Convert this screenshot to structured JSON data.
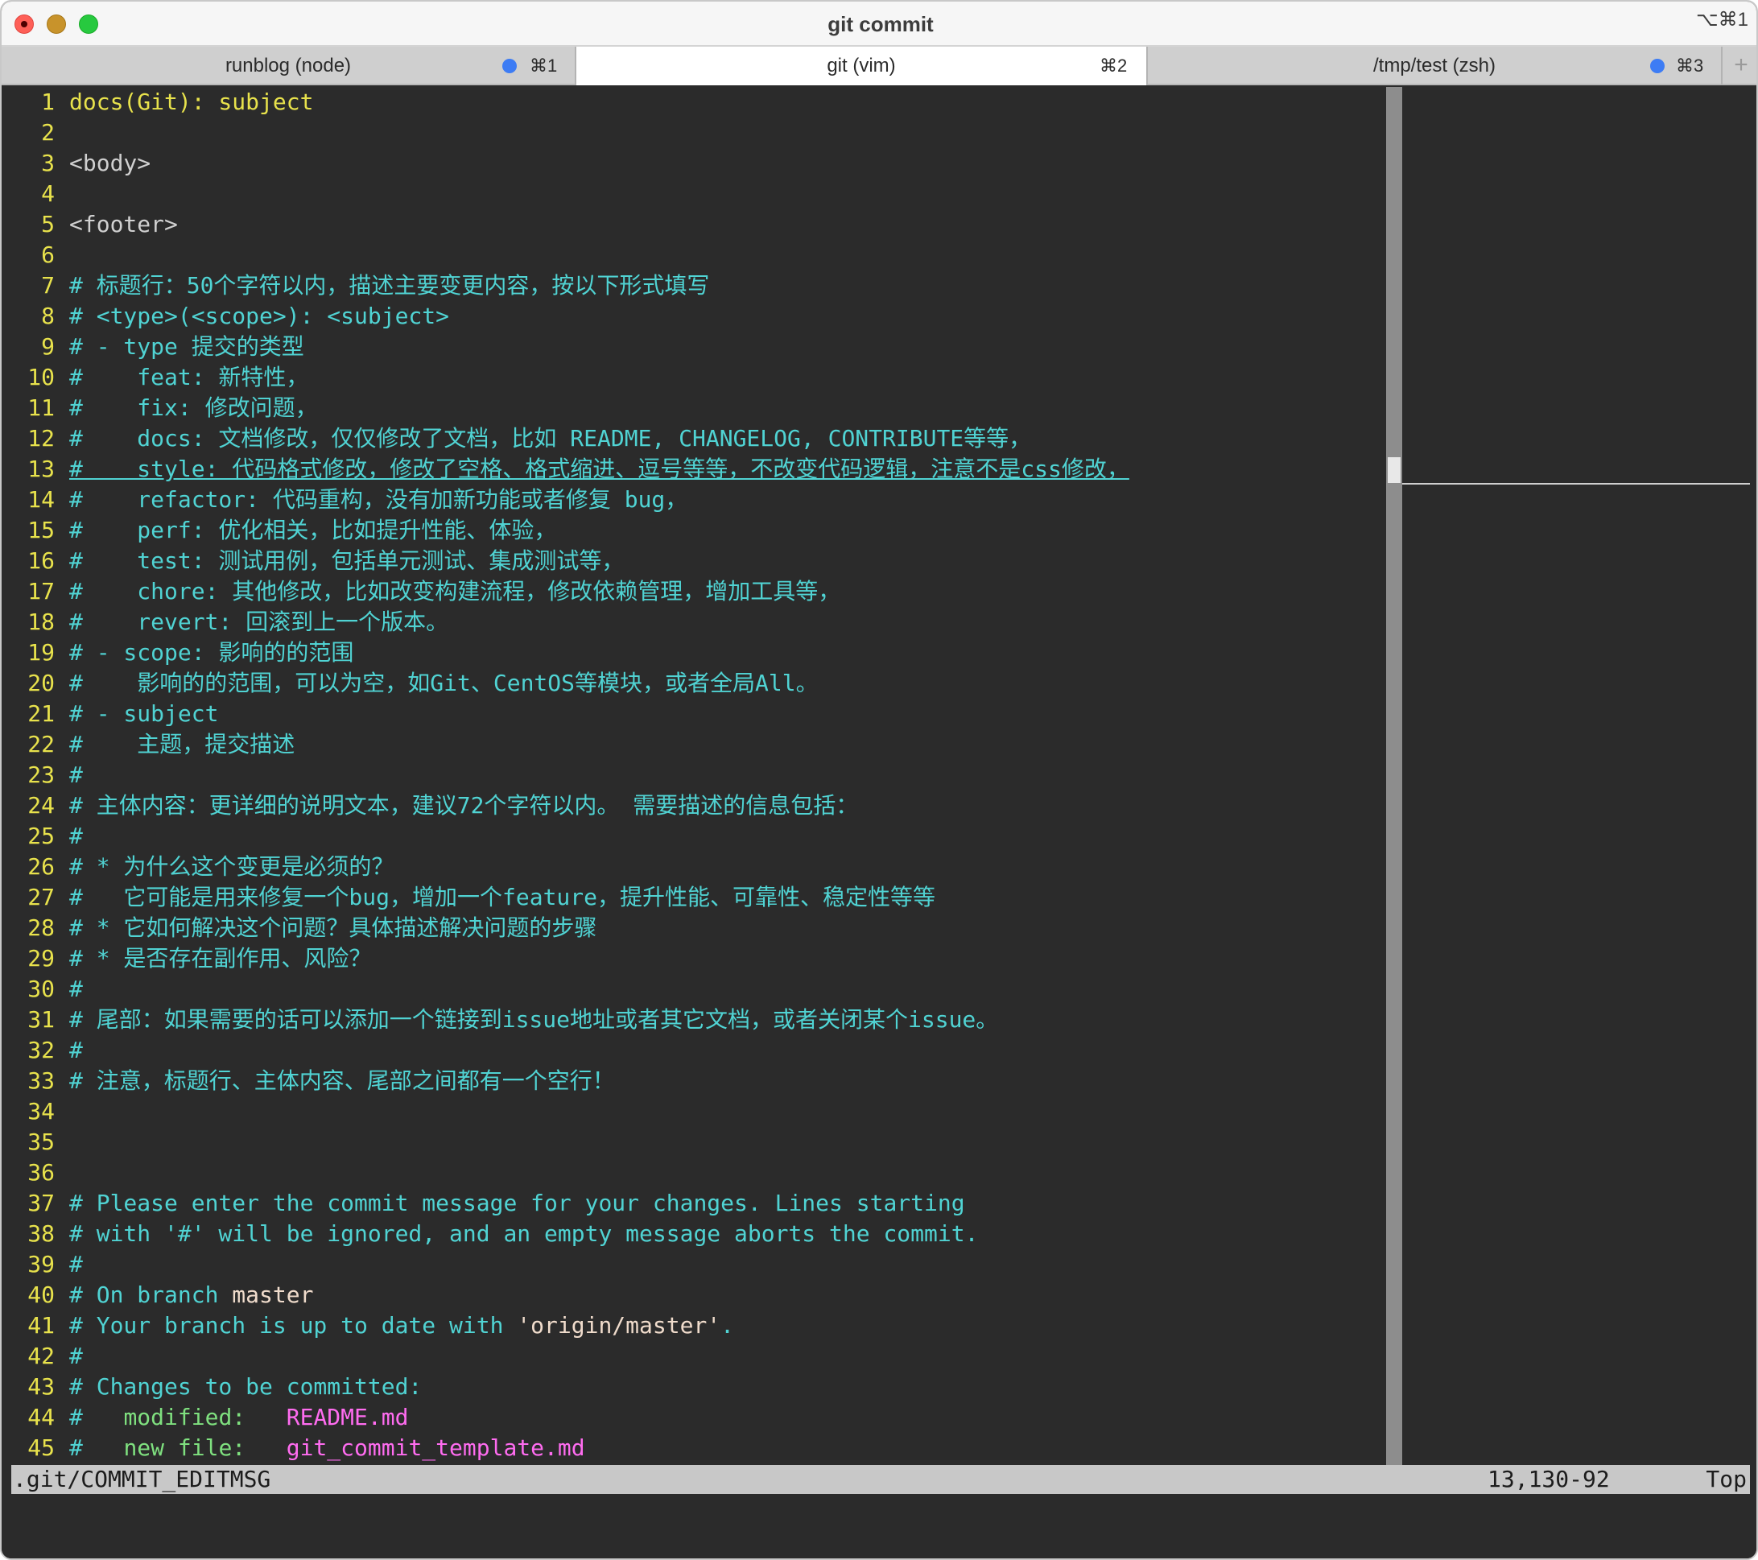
{
  "window": {
    "title": "git commit",
    "shortcut": "⌥⌘1"
  },
  "tabs": [
    {
      "label": "runblog (node)",
      "shortcut": "⌘1",
      "has_dot": true
    },
    {
      "label": "git (vim)",
      "shortcut": "⌘2",
      "has_dot": false,
      "active": true
    },
    {
      "label": "/tmp/test (zsh)",
      "shortcut": "⌘3",
      "has_dot": true
    }
  ],
  "add_tab_label": "+",
  "colors": {
    "line_number": "#e8e24c",
    "comment": "#50d3d3",
    "subject": "#e8e24c",
    "placeholder": "#d0d0d0",
    "branch": "#f0dccc",
    "status_green": "#7fe07f",
    "filename_magenta": "#ff6cf0",
    "tab_dot": "#3d7cf4"
  },
  "editor": {
    "cursor_line": 13,
    "lines": [
      {
        "n": "1",
        "segments": [
          {
            "t": "docs(Git): subject",
            "c": "sub"
          }
        ]
      },
      {
        "n": "2",
        "segments": []
      },
      {
        "n": "3",
        "segments": [
          {
            "t": "<body>",
            "c": "ph"
          }
        ]
      },
      {
        "n": "4",
        "segments": []
      },
      {
        "n": "5",
        "segments": [
          {
            "t": "<footer>",
            "c": "ph"
          }
        ]
      },
      {
        "n": "6",
        "segments": []
      },
      {
        "n": "7",
        "segments": [
          {
            "t": "# 标题行：50个字符以内，描述主要变更内容，按以下形式填写",
            "c": "com"
          }
        ]
      },
      {
        "n": "8",
        "segments": [
          {
            "t": "# <type>(<scope>): <subject>",
            "c": "com"
          }
        ]
      },
      {
        "n": "9",
        "segments": [
          {
            "t": "# - type 提交的类型",
            "c": "com"
          }
        ]
      },
      {
        "n": "10",
        "segments": [
          {
            "t": "#    feat: 新特性，",
            "c": "com"
          }
        ]
      },
      {
        "n": "11",
        "segments": [
          {
            "t": "#    fix: 修改问题，",
            "c": "com"
          }
        ]
      },
      {
        "n": "12",
        "segments": [
          {
            "t": "#    docs: 文档修改，仅仅修改了文档，比如 README, CHANGELOG, CONTRIBUTE等等，",
            "c": "com"
          }
        ]
      },
      {
        "n": "13",
        "segments": [
          {
            "t": "#    style: 代码格式修改，修改了空格、格式缩进、逗号等等，不改变代码逻辑，注意不是css修改，",
            "c": "com"
          }
        ]
      },
      {
        "n": "14",
        "segments": [
          {
            "t": "#    refactor: 代码重构，没有加新功能或者修复 bug，",
            "c": "com"
          }
        ]
      },
      {
        "n": "15",
        "segments": [
          {
            "t": "#    perf: 优化相关，比如提升性能、体验，",
            "c": "com"
          }
        ]
      },
      {
        "n": "16",
        "segments": [
          {
            "t": "#    test: 测试用例，包括单元测试、集成测试等，",
            "c": "com"
          }
        ]
      },
      {
        "n": "17",
        "segments": [
          {
            "t": "#    chore: 其他修改，比如改变构建流程，修改依赖管理，增加工具等，",
            "c": "com"
          }
        ]
      },
      {
        "n": "18",
        "segments": [
          {
            "t": "#    revert: 回滚到上一个版本。",
            "c": "com"
          }
        ]
      },
      {
        "n": "19",
        "segments": [
          {
            "t": "# - scope: 影响的的范围",
            "c": "com"
          }
        ]
      },
      {
        "n": "20",
        "segments": [
          {
            "t": "#    影响的的范围，可以为空，如Git、CentOS等模块，或者全局All。",
            "c": "com"
          }
        ]
      },
      {
        "n": "21",
        "segments": [
          {
            "t": "# - subject",
            "c": "com"
          }
        ]
      },
      {
        "n": "22",
        "segments": [
          {
            "t": "#    主题，提交描述",
            "c": "com"
          }
        ]
      },
      {
        "n": "23",
        "segments": [
          {
            "t": "#",
            "c": "com"
          }
        ]
      },
      {
        "n": "24",
        "segments": [
          {
            "t": "# 主体内容：更详细的说明文本，建议72个字符以内。 需要描述的信息包括：",
            "c": "com"
          }
        ]
      },
      {
        "n": "25",
        "segments": [
          {
            "t": "#",
            "c": "com"
          }
        ]
      },
      {
        "n": "26",
        "segments": [
          {
            "t": "# * 为什么这个变更是必须的？",
            "c": "com"
          }
        ]
      },
      {
        "n": "27",
        "segments": [
          {
            "t": "#   它可能是用来修复一个bug，增加一个feature，提升性能、可靠性、稳定性等等",
            "c": "com"
          }
        ]
      },
      {
        "n": "28",
        "segments": [
          {
            "t": "# * 它如何解决这个问题？具体描述解决问题的步骤",
            "c": "com"
          }
        ]
      },
      {
        "n": "29",
        "segments": [
          {
            "t": "# * 是否存在副作用、风险？",
            "c": "com"
          }
        ]
      },
      {
        "n": "30",
        "segments": [
          {
            "t": "#",
            "c": "com"
          }
        ]
      },
      {
        "n": "31",
        "segments": [
          {
            "t": "# 尾部：如果需要的话可以添加一个链接到issue地址或者其它文档，或者关闭某个issue。",
            "c": "com"
          }
        ]
      },
      {
        "n": "32",
        "segments": [
          {
            "t": "#",
            "c": "com"
          }
        ]
      },
      {
        "n": "33",
        "segments": [
          {
            "t": "# 注意，标题行、主体内容、尾部之间都有一个空行！",
            "c": "com"
          }
        ]
      },
      {
        "n": "34",
        "segments": []
      },
      {
        "n": "35",
        "segments": []
      },
      {
        "n": "36",
        "segments": []
      },
      {
        "n": "37",
        "segments": [
          {
            "t": "# Please enter the commit message for your changes. Lines starting",
            "c": "com"
          }
        ]
      },
      {
        "n": "38",
        "segments": [
          {
            "t": "# with '#' will be ignored, and an empty message aborts the commit.",
            "c": "com"
          }
        ]
      },
      {
        "n": "39",
        "segments": [
          {
            "t": "#",
            "c": "com"
          }
        ]
      },
      {
        "n": "40",
        "segments": [
          {
            "t": "# On branch ",
            "c": "com"
          },
          {
            "t": "master",
            "c": "white"
          }
        ]
      },
      {
        "n": "41",
        "segments": [
          {
            "t": "# Your branch is up to date with ",
            "c": "com"
          },
          {
            "t": "'origin/master'",
            "c": "white"
          },
          {
            "t": ".",
            "c": "com"
          }
        ]
      },
      {
        "n": "42",
        "segments": [
          {
            "t": "#",
            "c": "com"
          }
        ]
      },
      {
        "n": "43",
        "segments": [
          {
            "t": "# Changes to be committed:",
            "c": "com"
          }
        ]
      },
      {
        "n": "44",
        "segments": [
          {
            "t": "#   ",
            "c": "com"
          },
          {
            "t": "modified:   ",
            "c": "green"
          },
          {
            "t": "README.md",
            "c": "mag"
          }
        ]
      },
      {
        "n": "45",
        "segments": [
          {
            "t": "#   ",
            "c": "com"
          },
          {
            "t": "new file:   ",
            "c": "green"
          },
          {
            "t": "git_commit_template.md",
            "c": "mag"
          }
        ]
      }
    ]
  },
  "statusline": {
    "filename": ".git/COMMIT_EDITMSG",
    "position": "13,130-92",
    "scroll": "Top"
  }
}
